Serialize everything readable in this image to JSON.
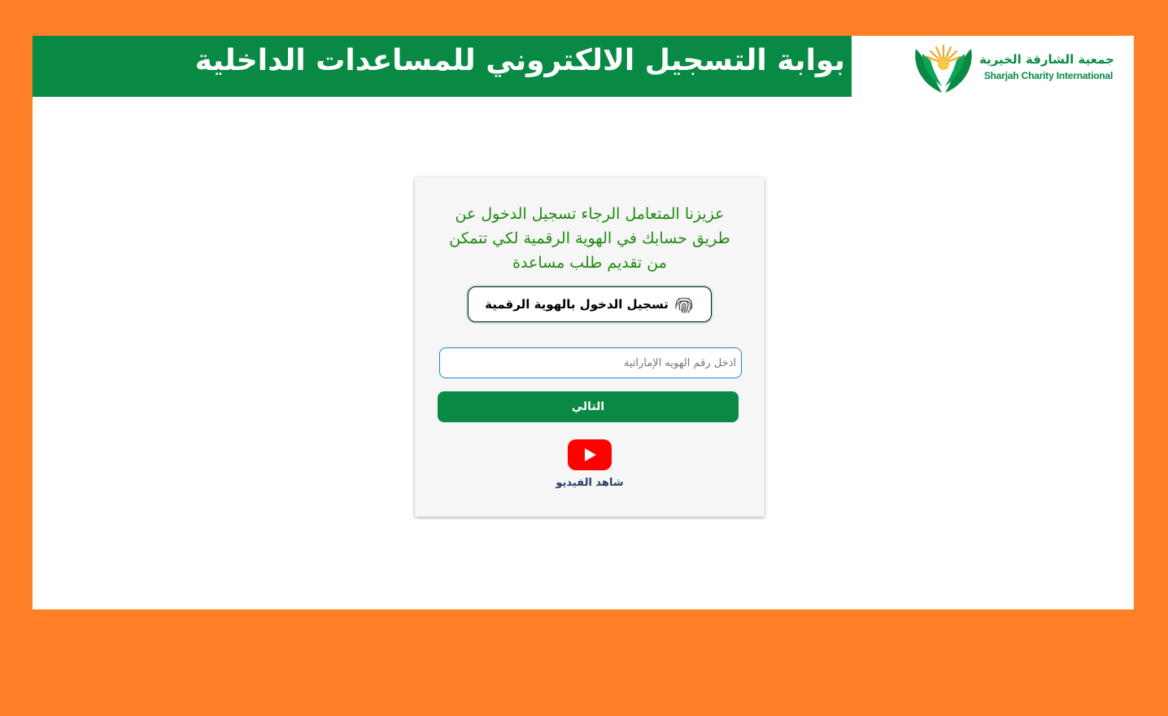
{
  "header": {
    "title": "بوابة التسجيل الالكتروني للمساعدات الداخلية",
    "logo": {
      "name_ar": "جمعية الشارقة الخيرية",
      "name_en": "Sharjah Charity International"
    }
  },
  "login_card": {
    "intro_text": "عزيزنا المتعامل الرجاء تسجيل الدخول عن طريق حسابك في الهوية الرقمية لكي تتمكن من تقديم طلب مساعدة",
    "uaepass_button_label": "تسجيل الدخول بالهوية الرقمية",
    "id_input": {
      "placeholder": "ادخل رقم الهويه الإماراتية",
      "value": ""
    },
    "next_button_label": "التالي",
    "video_link_label": "شاهد الفيديو"
  },
  "colors": {
    "background": "#FF7F27",
    "brand_green": "#088A44",
    "intro_text": "#1F8A10",
    "input_border": "#1E88C8",
    "youtube_red": "#FF0000"
  },
  "icons": {
    "fingerprint": "fingerprint-icon",
    "youtube": "youtube-play-icon",
    "logo": "hands-sun-logo-icon"
  }
}
